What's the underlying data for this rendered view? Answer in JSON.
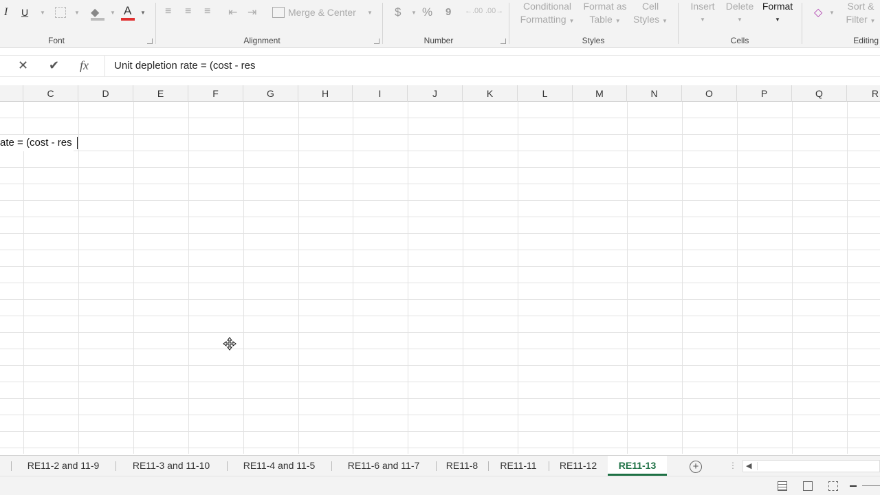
{
  "ribbon": {
    "groups": {
      "font": "Font",
      "alignment": "Alignment",
      "number": "Number",
      "styles": "Styles",
      "cells": "Cells",
      "editing": "Editing"
    },
    "font_buttons": {
      "italic": "I",
      "underline": "U",
      "font_color": "A"
    },
    "merge_center": "Merge & Center",
    "number_buttons": {
      "currency": "$",
      "percent": "%",
      "comma": "9"
    },
    "styles": {
      "conditional": [
        "Conditional",
        "Formatting"
      ],
      "format_table": [
        "Format as",
        "Table"
      ],
      "cell_styles": [
        "Cell",
        "Styles"
      ]
    },
    "cells": {
      "insert": "Insert",
      "delete": "Delete",
      "format": "Format"
    },
    "editing": {
      "sort_filter": [
        "Sort &",
        "Filter"
      ]
    }
  },
  "formula_bar": {
    "cancel": "✕",
    "enter": "✔",
    "fx": "fx",
    "content": "Unit depletion rate = (cost - res"
  },
  "columns": [
    "C",
    "D",
    "E",
    "F",
    "G",
    "H",
    "I",
    "J",
    "K",
    "L",
    "M",
    "N",
    "O",
    "P",
    "Q",
    "R"
  ],
  "grid": {
    "cell_text": "ate = (cost - res"
  },
  "sheet_tabs": [
    "RE11-2 and 11-9",
    "RE11-3 and 11-10",
    "RE11-4 and 11-5",
    "RE11-6 and 11-7",
    "RE11-8",
    "RE11-11",
    "RE11-12",
    "RE11-13"
  ],
  "active_sheet": "RE11-13",
  "add_sheet": "+",
  "colors": {
    "accent_green": "#1e7145",
    "font_red": "#e03030"
  }
}
